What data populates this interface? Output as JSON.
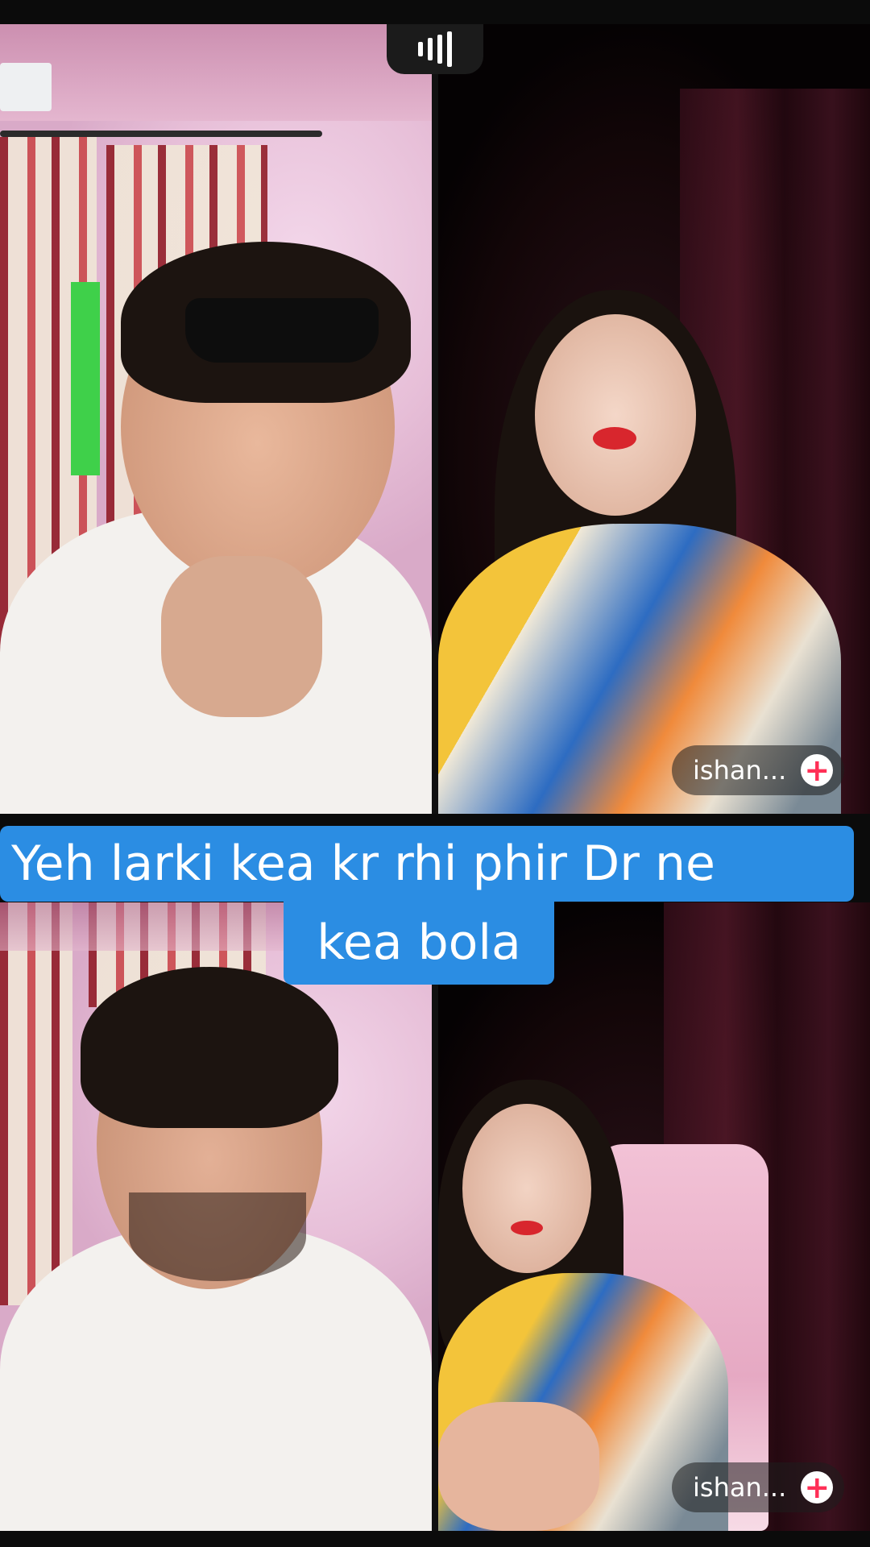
{
  "top_badge": {
    "icon": "signal-bars-icon"
  },
  "caption": {
    "line1": "Yeh larki kea kr rhi phir Dr ne",
    "line2": "kea bola",
    "color": "#2b8de3"
  },
  "top_call": {
    "guest_name": "ishan...",
    "follow_icon": "plus-icon"
  },
  "bottom_call": {
    "guest_name": "ishan...",
    "follow_icon": "plus-icon"
  },
  "accent": {
    "follow": "#ff2f56"
  }
}
